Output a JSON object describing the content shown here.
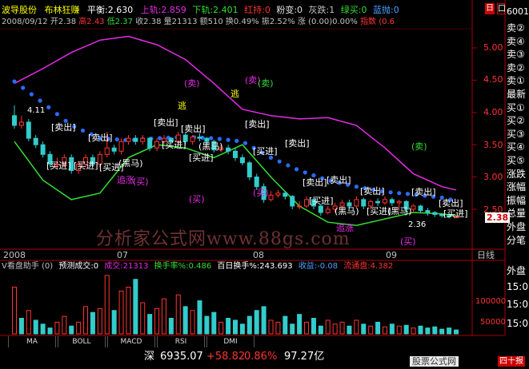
{
  "header": {
    "stock_name": "波导股份",
    "indicator_name": "布林狂赚",
    "balance_label": "平衡",
    "balance_value": ":2.630",
    "upper_label": "上轨",
    "upper_value": ":2.859",
    "lower_label": "下轨",
    "lower_value": ":2.401",
    "red_label": "红持",
    "red_value": ":0",
    "pink_label": "粉变",
    "pink_value": ":0",
    "gray_label": "灰跌",
    "gray_value": ":1",
    "green_label": "绿买",
    "green_value": ":0",
    "blue_label": "蓝抛",
    "blue_value": ":0",
    "line2_date": "2008/09/12",
    "line2_open": "开2.38",
    "line2_high": "高2.43",
    "line2_low": "低2.37",
    "line2_close": "收2.38",
    "line2_volume": "量21313",
    "line2_amount": "额510",
    "line2_turnover": "换0.49%",
    "line2_amplitude": "振2.52%",
    "line2_change": "涨 (0.00)0.00%",
    "line2_index": "指数 (0.6"
  },
  "price_axis": {
    "labels": [
      "5.00",
      "4.50",
      "4.00",
      "3.50",
      "3.00",
      "2.50"
    ],
    "current_price": "2.38",
    "max_marker": "4.11",
    "min_marker": "2.36"
  },
  "date_axis": {
    "labels": [
      "2008",
      "07",
      "08",
      "09"
    ],
    "unit_label": "日线"
  },
  "signals": {
    "sell": "[卖出]",
    "buy": "[买进]",
    "black_horse": "(黑马)",
    "sell_small": "(卖)",
    "buy_small": "(买)",
    "escape": "逃",
    "chase": "追涨",
    "green_sell": "(卖)"
  },
  "watermark": "分析家公式网www.88gs.com",
  "volume_panel": {
    "title": "V看盘助手 (0)",
    "forecast_label": "预测成交:0",
    "deal_label": "成交",
    "deal_value": ":21313",
    "turnover_label": "换手率%",
    "turnover_value": ":0.486",
    "hundred_day_label": "百日换手%",
    "hundred_day_value": ":243.693",
    "profit_label": "收益",
    "profit_value": ":-0.08",
    "float_label": "流通盘",
    "float_value": ":4.382",
    "axis_label": "100000",
    "axis_label2": "50000"
  },
  "right_panel": {
    "code": "600130",
    "items": [
      "卖②",
      "卖④",
      "卖③",
      "卖②",
      "卖①",
      "最新",
      "买①",
      "买②",
      "买③",
      "买④",
      "买⑤",
      "涨跌",
      "涨幅",
      "振幅",
      "总量",
      "外盘",
      "分笔"
    ],
    "bottom_items": [
      "外盘",
      "15:0",
      "15:0",
      "15:0"
    ],
    "tab_chars": [
      "日",
      "口"
    ]
  },
  "tabs": [
    "MA",
    "BOLL",
    "MACD",
    "RSI",
    "DMI"
  ],
  "ticker": {
    "market": "深",
    "index_value": "6935.07",
    "change": "+58.82",
    "pct": "0.86%",
    "amount": "97.27亿",
    "website": "股票公式网",
    "extra": "四十报"
  },
  "chart_data": [
    {
      "type": "line",
      "title": "布林狂赚",
      "ylim": [
        2.1,
        5.3
      ],
      "series": [
        {
          "name": "上轨",
          "color": "#e62be6",
          "x": [
            0,
            4,
            8,
            12,
            16,
            20,
            24,
            28,
            32,
            36,
            40,
            44,
            48,
            52,
            56,
            60,
            62
          ],
          "values": [
            4.45,
            4.68,
            4.93,
            5.12,
            5.18,
            5.05,
            4.82,
            4.45,
            4.05,
            3.95,
            3.9,
            3.92,
            3.8,
            3.45,
            3.05,
            2.85,
            2.8
          ]
        },
        {
          "name": "平衡",
          "color": "#2b6bff",
          "x": [
            0,
            4,
            8,
            12,
            16,
            20,
            24,
            28,
            32,
            36,
            40,
            44,
            48,
            52,
            56,
            60,
            62
          ],
          "values": [
            4.48,
            4.15,
            3.8,
            3.6,
            3.57,
            3.6,
            3.62,
            3.6,
            3.55,
            3.3,
            3.1,
            2.95,
            2.85,
            2.77,
            2.73,
            2.68,
            2.63
          ]
        },
        {
          "name": "下轨",
          "color": "#33dd33",
          "x": [
            0,
            4,
            8,
            12,
            16,
            20,
            24,
            28,
            32,
            36,
            40,
            44,
            48,
            52,
            56,
            60,
            62
          ],
          "values": [
            3.55,
            2.95,
            2.65,
            2.75,
            3.3,
            3.5,
            3.45,
            3.3,
            3.5,
            3.0,
            2.55,
            2.3,
            2.25,
            2.35,
            2.45,
            2.43,
            2.4
          ]
        }
      ],
      "candles": {
        "x": [
          0,
          1,
          2,
          3,
          4,
          5,
          6,
          7,
          8,
          9,
          10,
          11,
          12,
          13,
          14,
          15,
          16,
          17,
          18,
          19,
          20,
          21,
          22,
          23,
          24,
          25,
          26,
          27,
          28,
          29,
          30,
          31,
          32,
          33,
          34,
          35,
          36,
          37,
          38,
          39,
          40,
          41,
          42,
          43,
          44,
          45,
          46,
          47,
          48,
          49,
          50,
          51,
          52,
          53,
          54,
          55,
          56,
          57,
          58,
          59,
          60,
          61,
          62
        ],
        "open": [
          3.95,
          3.8,
          3.85,
          3.6,
          3.5,
          3.35,
          3.2,
          3.2,
          3.3,
          3.1,
          3.2,
          3.3,
          3.2,
          3.35,
          3.45,
          3.4,
          3.55,
          3.6,
          3.55,
          3.6,
          3.45,
          3.55,
          3.6,
          3.55,
          3.65,
          3.55,
          3.62,
          3.6,
          3.55,
          3.42,
          3.45,
          3.4,
          3.3,
          3.22,
          3.0,
          2.85,
          2.65,
          2.72,
          2.75,
          2.7,
          2.55,
          2.55,
          2.65,
          2.55,
          2.45,
          2.5,
          2.55,
          2.6,
          2.55,
          2.65,
          2.55,
          2.62,
          2.6,
          2.65,
          2.6,
          2.62,
          2.5,
          2.55,
          2.48,
          2.45,
          2.42,
          2.4,
          2.38
        ],
        "close": [
          3.8,
          3.85,
          3.6,
          3.5,
          3.35,
          3.2,
          3.2,
          3.3,
          3.1,
          3.2,
          3.3,
          3.2,
          3.35,
          3.45,
          3.4,
          3.55,
          3.6,
          3.55,
          3.6,
          3.45,
          3.55,
          3.6,
          3.55,
          3.65,
          3.55,
          3.62,
          3.6,
          3.55,
          3.42,
          3.45,
          3.4,
          3.3,
          3.22,
          3.0,
          2.85,
          2.65,
          2.72,
          2.75,
          2.7,
          2.55,
          2.55,
          2.65,
          2.55,
          2.45,
          2.5,
          2.55,
          2.6,
          2.55,
          2.65,
          2.55,
          2.62,
          2.6,
          2.65,
          2.6,
          2.62,
          2.5,
          2.55,
          2.48,
          2.45,
          2.42,
          2.4,
          2.38,
          2.38
        ],
        "high": [
          4.11,
          3.95,
          3.9,
          3.65,
          3.55,
          3.4,
          3.3,
          3.35,
          3.35,
          3.25,
          3.35,
          3.35,
          3.4,
          3.7,
          3.5,
          3.6,
          3.65,
          3.65,
          3.65,
          3.62,
          3.6,
          3.65,
          3.62,
          3.7,
          3.68,
          3.65,
          3.68,
          3.62,
          3.58,
          3.5,
          3.5,
          3.45,
          3.35,
          3.25,
          3.05,
          2.9,
          2.78,
          2.8,
          2.78,
          2.72,
          2.62,
          2.7,
          2.68,
          2.58,
          2.55,
          2.6,
          2.65,
          2.65,
          2.7,
          2.68,
          2.65,
          2.67,
          2.7,
          2.68,
          2.65,
          2.64,
          2.58,
          2.57,
          2.52,
          2.47,
          2.44,
          2.43,
          2.43
        ],
        "low": [
          3.75,
          3.75,
          3.55,
          3.45,
          3.3,
          3.15,
          3.12,
          3.15,
          3.05,
          3.05,
          3.15,
          3.15,
          3.15,
          3.3,
          3.35,
          3.35,
          3.5,
          3.5,
          3.5,
          3.4,
          3.4,
          3.5,
          3.5,
          3.5,
          3.5,
          3.5,
          3.55,
          3.5,
          3.38,
          3.38,
          3.35,
          3.25,
          3.18,
          2.95,
          2.8,
          2.6,
          2.62,
          2.68,
          2.65,
          2.5,
          2.5,
          2.52,
          2.5,
          2.4,
          2.42,
          2.45,
          2.5,
          2.5,
          2.52,
          2.5,
          2.5,
          2.55,
          2.57,
          2.55,
          2.48,
          2.45,
          2.45,
          2.44,
          2.4,
          2.38,
          2.37,
          2.36,
          2.37
        ]
      }
    },
    {
      "type": "bar",
      "title": "V看盘助手",
      "ylim": [
        0,
        160000
      ],
      "x": [
        0,
        1,
        2,
        3,
        4,
        5,
        6,
        7,
        8,
        9,
        10,
        11,
        12,
        13,
        14,
        15,
        16,
        17,
        18,
        19,
        20,
        21,
        22,
        23,
        24,
        25,
        26,
        27,
        28,
        29,
        30,
        31,
        32,
        33,
        34,
        35,
        36,
        37,
        38,
        39,
        40,
        41,
        42,
        43,
        44,
        45,
        46,
        47,
        48,
        49,
        50,
        51,
        52,
        53,
        54,
        55,
        56,
        57,
        58,
        59,
        60,
        61,
        62
      ],
      "values": [
        120000,
        40000,
        60000,
        35000,
        25000,
        15000,
        30000,
        45000,
        20000,
        30000,
        70000,
        55000,
        65000,
        150000,
        60000,
        110000,
        120000,
        140000,
        80000,
        50000,
        65000,
        90000,
        40000,
        100000,
        70000,
        60000,
        85000,
        45000,
        55000,
        30000,
        40000,
        35000,
        25000,
        45000,
        60000,
        70000,
        35000,
        30000,
        45000,
        25000,
        50000,
        30000,
        40000,
        20000,
        35000,
        25000,
        30000,
        20000,
        35000,
        25000,
        20000,
        30000,
        18000,
        25000,
        20000,
        22000,
        15000,
        20000,
        15000,
        18000,
        12000,
        15000,
        10000
      ],
      "colors": [
        "red",
        "cyan",
        "red",
        "cyan",
        "cyan",
        "cyan",
        "red",
        "red",
        "cyan",
        "red",
        "red",
        "cyan",
        "red",
        "red",
        "cyan",
        "red",
        "red",
        "cyan",
        "red",
        "cyan",
        "red",
        "red",
        "cyan",
        "red",
        "cyan",
        "red",
        "cyan",
        "cyan",
        "cyan",
        "red",
        "cyan",
        "cyan",
        "cyan",
        "cyan",
        "cyan",
        "cyan",
        "red",
        "red",
        "cyan",
        "cyan",
        "cyan",
        "red",
        "cyan",
        "cyan",
        "red",
        "red",
        "red",
        "cyan",
        "red",
        "cyan",
        "red",
        "cyan",
        "red",
        "cyan",
        "red",
        "cyan",
        "red",
        "cyan",
        "cyan",
        "cyan",
        "cyan",
        "cyan",
        "cyan"
      ]
    }
  ]
}
